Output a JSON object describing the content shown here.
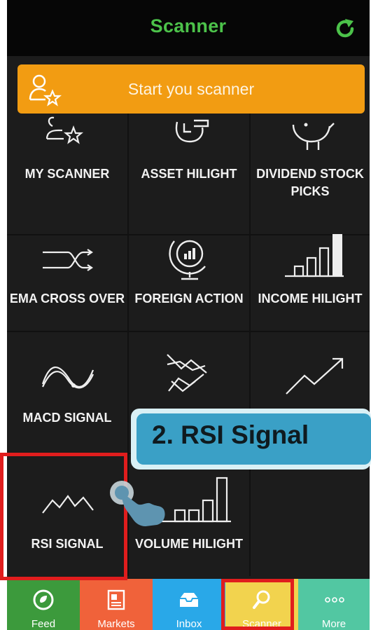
{
  "header": {
    "title": "Scanner"
  },
  "start_button": {
    "label": "Start you scanner"
  },
  "grid": {
    "items": [
      {
        "label": "MY SCANNER",
        "icon": "scanner-star-icon"
      },
      {
        "label": "ASSET HILIGHT",
        "icon": "asset-icon"
      },
      {
        "label": "DIVIDEND STOCK PICKS",
        "icon": "piggy-bank-icon"
      },
      {
        "label": "EMA CROSS OVER",
        "icon": "cross-lines-icon"
      },
      {
        "label": "FOREIGN ACTION",
        "icon": "globe-chart-icon"
      },
      {
        "label": "INCOME HILIGHT",
        "icon": "bar-chart-icon"
      },
      {
        "label": "MACD SIGNAL",
        "icon": "wave-icon"
      },
      {
        "label": "",
        "icon": "crossing-trend-icon"
      },
      {
        "label": "",
        "icon": "trend-up-icon"
      },
      {
        "label": "RSI SIGNAL",
        "icon": "zigzag-icon"
      },
      {
        "label": "VOLUME HILIGHT",
        "icon": "volume-bars-icon"
      }
    ]
  },
  "callout": {
    "text": "2. RSI Signal"
  },
  "tabbar": {
    "tabs": [
      {
        "label": "Feed",
        "color": "#3c9a3c"
      },
      {
        "label": "Markets",
        "color": "#f0623a"
      },
      {
        "label": "Inbox",
        "color": "#29a8e8"
      },
      {
        "label": "Scanner",
        "color": "#f2d34e"
      },
      {
        "label": "More",
        "color": "#52c7a2"
      }
    ]
  },
  "colors": {
    "accent": "#4cc24a",
    "orange": "#f29c12",
    "highlight": "#e01d1d"
  }
}
